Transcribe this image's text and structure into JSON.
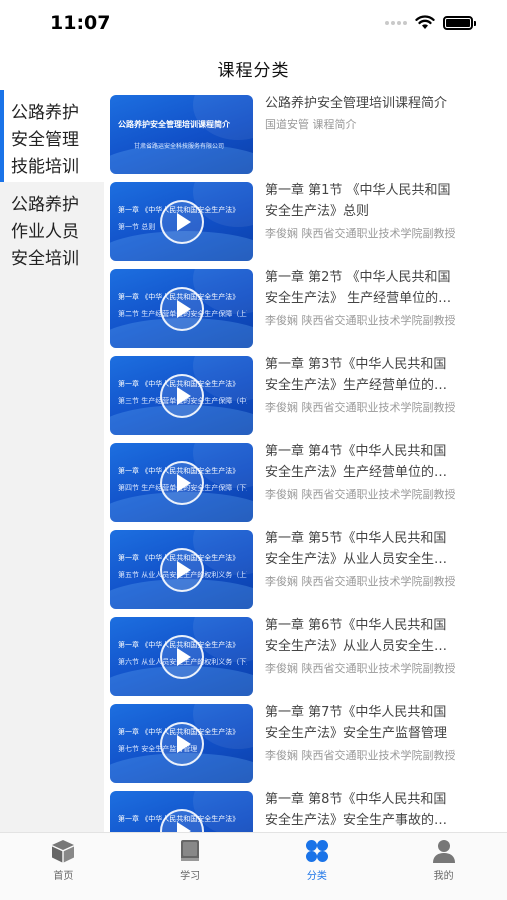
{
  "status_bar": {
    "time": "11:07"
  },
  "nav": {
    "title": "课程分类"
  },
  "sidebar": {
    "items": [
      {
        "label": "公路养护安全管理技能培训",
        "lines": [
          "公路养护",
          "安全管理",
          "技能培训"
        ],
        "active": true
      },
      {
        "label": "公路养护作业人员安全培训",
        "lines": [
          "公路养护",
          "作业人员",
          "安全培训"
        ],
        "active": false
      }
    ]
  },
  "courses": [
    {
      "title_lines": [
        "公路养护安全管理培训课程简介"
      ],
      "meta": "国道安管 课程简介",
      "thumb_line1": "公路养护安全管理培训课程简介",
      "thumb_line2": "甘肃省路运安全科技服务有限公司"
    },
    {
      "title_lines": [
        "第一章 第1节 《中华人民共和国",
        "安全生产法》总则"
      ],
      "meta": "李俊娴 陕西省交通职业技术学院副教授",
      "thumb_line1": "第一章  《中华人民共和国安全生产法》",
      "thumb_line2": "第一节  总则"
    },
    {
      "title_lines": [
        "第一章 第2节 《中华人民共和国",
        "安全生产法》 生产经营单位的…"
      ],
      "meta": "李俊娴 陕西省交通职业技术学院副教授",
      "thumb_line1": "第一章  《中华人民共和国安全生产法》",
      "thumb_line2": "第二节  生产经营单位的安全生产保障（上）"
    },
    {
      "title_lines": [
        "第一章 第3节《中华人民共和国",
        "安全生产法》生产经营单位的…"
      ],
      "meta": "李俊娴 陕西省交通职业技术学院副教授",
      "thumb_line1": "第一章  《中华人民共和国安全生产法》",
      "thumb_line2": "第三节  生产经营单位的安全生产保障（中）"
    },
    {
      "title_lines": [
        "第一章 第4节《中华人民共和国",
        "安全生产法》生产经营单位的…"
      ],
      "meta": "李俊娴 陕西省交通职业技术学院副教授",
      "thumb_line1": "第一章  《中华人民共和国安全生产法》",
      "thumb_line2": "第四节  生产经营单位的安全生产保障（下）"
    },
    {
      "title_lines": [
        "第一章 第5节《中华人民共和国",
        "安全生产法》从业人员安全生…"
      ],
      "meta": "李俊娴 陕西省交通职业技术学院副教授",
      "thumb_line1": "第一章  《中华人民共和国安全生产法》",
      "thumb_line2": "第五节  从业人员安全生产的权利义务（上）"
    },
    {
      "title_lines": [
        "第一章 第6节《中华人民共和国",
        "安全生产法》从业人员安全生…"
      ],
      "meta": "李俊娴 陕西省交通职业技术学院副教授",
      "thumb_line1": "第一章  《中华人民共和国安全生产法》",
      "thumb_line2": "第六节  从业人员安全生产的权利义务（下）"
    },
    {
      "title_lines": [
        "第一章 第7节《中华人民共和国",
        "安全生产法》安全生产监督管理"
      ],
      "meta": "李俊娴 陕西省交通职业技术学院副教授",
      "thumb_line1": "第一章  《中华人民共和国安全生产法》",
      "thumb_line2": "第七节  安全生产监督管理"
    },
    {
      "title_lines": [
        "第一章 第8节《中华人民共和国",
        "安全生产法》安全生产事故的…"
      ],
      "meta": "",
      "thumb_line1": "第一章  《中华人民共和国安全生产法》",
      "thumb_line2": ""
    }
  ],
  "tab_bar": {
    "tabs": [
      {
        "label": "首页",
        "icon": "box-icon",
        "active": false
      },
      {
        "label": "学习",
        "icon": "book-icon",
        "active": false
      },
      {
        "label": "分类",
        "icon": "category-grid-icon",
        "active": true
      },
      {
        "label": "我的",
        "icon": "person-icon",
        "active": false
      }
    ]
  },
  "colors": {
    "accent": "#1a73e8",
    "thumb_blue": "#1458d6",
    "sidebar_bg": "#f2f2f2"
  }
}
